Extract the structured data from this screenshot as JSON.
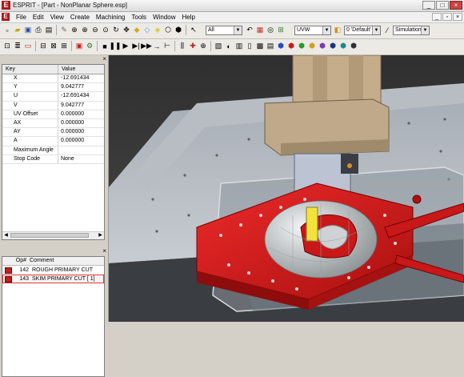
{
  "window": {
    "title": "ESPRIT - [Part - NonPlanar Sphere.esp]",
    "app_icon": "E",
    "buttons": [
      "_",
      "□",
      "×"
    ]
  },
  "menu": {
    "items": [
      "File",
      "Edit",
      "View",
      "Create",
      "Machining",
      "Tools",
      "Window",
      "Help"
    ],
    "mdi_buttons": [
      "_",
      "▫",
      "×"
    ]
  },
  "toolbar": {
    "layer_combo": "All",
    "workplane_combo": "UVW",
    "color_combo": "0 'Default'",
    "simulation_combo": "Simulation"
  },
  "properties": {
    "header_key": "Key",
    "header_value": "Value",
    "rows": [
      {
        "key": "X",
        "value": "-12.691434"
      },
      {
        "key": "Y",
        "value": "9.042777"
      },
      {
        "key": "U",
        "value": "-12.691434"
      },
      {
        "key": "V",
        "value": "9.042777"
      },
      {
        "key": "UV Offset",
        "value": "0.000000"
      },
      {
        "key": "AX",
        "value": "0.000000"
      },
      {
        "key": "AY",
        "value": "0.000000"
      },
      {
        "key": "A",
        "value": "0.000000"
      },
      {
        "key": "Maximum Angle",
        "value": ""
      },
      {
        "key": "Stop Code",
        "value": "None"
      }
    ]
  },
  "operations": {
    "header_num": "Op#",
    "header_comment": "Comment",
    "rows": [
      {
        "num": "142",
        "comment": "ROUGH PRIMARY CUT"
      },
      {
        "num": "143",
        "comment": "SKIM PRIMARY CUT [ 1]"
      }
    ],
    "selected_index": 1
  },
  "colors": {
    "table_red": "#d81e1e",
    "yellow_plate": "#f2e23c",
    "machine_tan": "#bfa98a",
    "sphere_grey": "#cfd2d4",
    "app_red": "#b01818"
  }
}
